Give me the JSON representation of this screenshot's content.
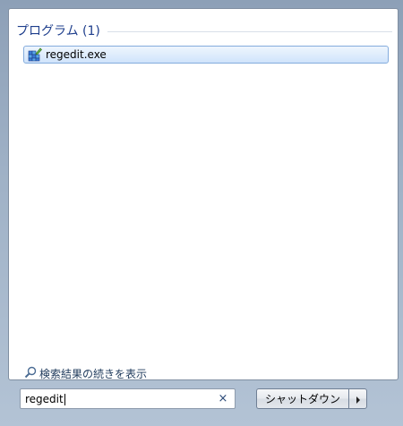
{
  "results": {
    "section_title": "プログラム (1)",
    "items": [
      {
        "label": "regedit.exe",
        "icon": "registry-editor-icon"
      }
    ]
  },
  "see_more": {
    "label": "検索結果の続きを表示",
    "icon": "magnifier-icon"
  },
  "search": {
    "value": "regedit",
    "clear_label": "×"
  },
  "shutdown": {
    "label": "シャットダウン",
    "arrow_icon": "arrow-right-icon"
  }
}
